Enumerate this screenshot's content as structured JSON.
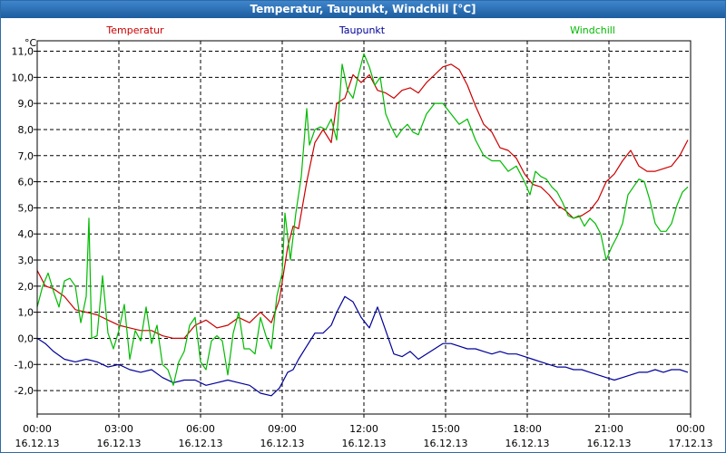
{
  "window": {
    "title": "Temperatur, Taupunkt, Windchill [°C]"
  },
  "chart_data": {
    "type": "line",
    "title": "Temperatur, Taupunkt, Windchill [°C]",
    "ylabel": "°C",
    "ylim": [
      -2.9,
      11.4
    ],
    "xlim": [
      0,
      24
    ],
    "grid": true,
    "y_ticks": [
      "11,0",
      "10,0",
      "9,0",
      "8,0",
      "7,0",
      "6,0",
      "5,0",
      "4,0",
      "3,0",
      "2,0",
      "1,0",
      "0,0",
      "-1,0",
      "-2,0"
    ],
    "y_tick_values": [
      11,
      10,
      9,
      8,
      7,
      6,
      5,
      4,
      3,
      2,
      1,
      0,
      -1,
      -2
    ],
    "x_ticks": [
      {
        "hour": 0,
        "time": "00:00",
        "date": "16.12.13"
      },
      {
        "hour": 3,
        "time": "03:00",
        "date": "16.12.13"
      },
      {
        "hour": 6,
        "time": "06:00",
        "date": "16.12.13"
      },
      {
        "hour": 9,
        "time": "09:00",
        "date": "16.12.13"
      },
      {
        "hour": 12,
        "time": "12:00",
        "date": "16.12.13"
      },
      {
        "hour": 15,
        "time": "15:00",
        "date": "16.12.13"
      },
      {
        "hour": 18,
        "time": "18:00",
        "date": "16.12.13"
      },
      {
        "hour": 21,
        "time": "21:00",
        "date": "16.12.13"
      },
      {
        "hour": 24,
        "time": "00:00",
        "date": "17.12.13"
      }
    ],
    "series": [
      {
        "name": "Temperatur",
        "color": "#cc0000",
        "x": [
          0,
          0.3,
          0.6,
          1.0,
          1.4,
          1.8,
          2.2,
          2.6,
          3.0,
          3.4,
          3.8,
          4.2,
          4.6,
          5.0,
          5.4,
          5.8,
          6.2,
          6.6,
          7.0,
          7.4,
          7.8,
          8.2,
          8.6,
          8.9,
          9.2,
          9.4,
          9.6,
          9.9,
          10.2,
          10.5,
          10.8,
          11.0,
          11.3,
          11.6,
          11.9,
          12.2,
          12.5,
          12.8,
          13.1,
          13.4,
          13.7,
          14.0,
          14.3,
          14.6,
          14.9,
          15.2,
          15.5,
          15.8,
          16.1,
          16.4,
          16.7,
          17.0,
          17.3,
          17.6,
          17.9,
          18.2,
          18.5,
          18.8,
          19.1,
          19.4,
          19.7,
          20.0,
          20.3,
          20.6,
          20.9,
          21.2,
          21.5,
          21.8,
          22.1,
          22.4,
          22.7,
          23.0,
          23.3,
          23.6,
          23.9
        ],
        "y": [
          2.6,
          2.0,
          1.9,
          1.6,
          1.1,
          1.0,
          0.9,
          0.7,
          0.5,
          0.4,
          0.3,
          0.3,
          0.1,
          0.0,
          0.0,
          0.5,
          0.7,
          0.4,
          0.5,
          0.8,
          0.6,
          1.0,
          0.6,
          1.5,
          3.5,
          4.3,
          4.2,
          6.0,
          7.5,
          8.0,
          7.5,
          9.0,
          9.2,
          10.1,
          9.8,
          10.1,
          9.5,
          9.4,
          9.2,
          9.5,
          9.6,
          9.4,
          9.8,
          10.1,
          10.4,
          10.5,
          10.3,
          9.7,
          8.9,
          8.2,
          7.9,
          7.3,
          7.2,
          6.9,
          6.3,
          5.9,
          5.8,
          5.5,
          5.1,
          4.9,
          4.6,
          4.7,
          4.9,
          5.3,
          6.0,
          6.3,
          6.8,
          7.2,
          6.6,
          6.4,
          6.4,
          6.5,
          6.6,
          7.0,
          7.6
        ]
      },
      {
        "name": "Taupunkt",
        "color": "#000099",
        "x": [
          0,
          0.3,
          0.6,
          1.0,
          1.4,
          1.8,
          2.2,
          2.6,
          3.0,
          3.4,
          3.8,
          4.2,
          4.6,
          5.0,
          5.4,
          5.8,
          6.2,
          6.6,
          7.0,
          7.4,
          7.8,
          8.2,
          8.6,
          8.9,
          9.2,
          9.4,
          9.6,
          9.9,
          10.2,
          10.5,
          10.8,
          11.0,
          11.3,
          11.6,
          11.9,
          12.2,
          12.5,
          12.8,
          13.1,
          13.4,
          13.7,
          14.0,
          14.3,
          14.6,
          14.9,
          15.2,
          15.5,
          15.8,
          16.1,
          16.4,
          16.7,
          17.0,
          17.3,
          17.6,
          17.9,
          18.2,
          18.5,
          18.8,
          19.1,
          19.4,
          19.7,
          20.0,
          20.3,
          20.6,
          20.9,
          21.2,
          21.5,
          21.8,
          22.1,
          22.4,
          22.7,
          23.0,
          23.3,
          23.6,
          23.9
        ],
        "y": [
          0.0,
          -0.2,
          -0.5,
          -0.8,
          -0.9,
          -0.8,
          -0.9,
          -1.1,
          -1.0,
          -1.2,
          -1.3,
          -1.2,
          -1.5,
          -1.7,
          -1.6,
          -1.6,
          -1.8,
          -1.7,
          -1.6,
          -1.7,
          -1.8,
          -2.1,
          -2.2,
          -1.9,
          -1.3,
          -1.2,
          -0.8,
          -0.3,
          0.2,
          0.2,
          0.5,
          1.0,
          1.6,
          1.4,
          0.8,
          0.4,
          1.2,
          0.3,
          -0.6,
          -0.7,
          -0.5,
          -0.8,
          -0.6,
          -0.4,
          -0.2,
          -0.2,
          -0.3,
          -0.4,
          -0.4,
          -0.5,
          -0.6,
          -0.5,
          -0.6,
          -0.6,
          -0.7,
          -0.8,
          -0.9,
          -1.0,
          -1.1,
          -1.1,
          -1.2,
          -1.2,
          -1.3,
          -1.4,
          -1.5,
          -1.6,
          -1.5,
          -1.4,
          -1.3,
          -1.3,
          -1.2,
          -1.3,
          -1.2,
          -1.2,
          -1.3
        ]
      },
      {
        "name": "Windchill",
        "color": "#00bb00",
        "x": [
          0,
          0.2,
          0.4,
          0.6,
          0.8,
          1.0,
          1.2,
          1.4,
          1.6,
          1.8,
          1.9,
          2.0,
          2.2,
          2.4,
          2.6,
          2.8,
          3.0,
          3.2,
          3.4,
          3.6,
          3.8,
          4.0,
          4.2,
          4.4,
          4.6,
          4.8,
          5.0,
          5.2,
          5.4,
          5.6,
          5.8,
          6.0,
          6.2,
          6.4,
          6.6,
          6.8,
          7.0,
          7.2,
          7.4,
          7.6,
          7.8,
          8.0,
          8.2,
          8.4,
          8.6,
          8.8,
          9.0,
          9.1,
          9.3,
          9.5,
          9.7,
          9.9,
          10.0,
          10.2,
          10.4,
          10.6,
          10.8,
          11.0,
          11.2,
          11.4,
          11.6,
          11.8,
          12.0,
          12.2,
          12.4,
          12.6,
          12.8,
          13.0,
          13.2,
          13.4,
          13.6,
          13.8,
          14.0,
          14.3,
          14.6,
          14.9,
          15.2,
          15.5,
          15.8,
          16.1,
          16.4,
          16.7,
          17.0,
          17.3,
          17.6,
          17.9,
          18.1,
          18.3,
          18.5,
          18.7,
          18.9,
          19.1,
          19.3,
          19.5,
          19.7,
          19.9,
          20.1,
          20.3,
          20.5,
          20.7,
          20.9,
          21.1,
          21.3,
          21.5,
          21.7,
          21.9,
          22.1,
          22.3,
          22.5,
          22.7,
          22.9,
          23.1,
          23.3,
          23.5,
          23.7,
          23.9
        ],
        "y": [
          1.2,
          2.0,
          2.5,
          1.8,
          1.2,
          2.2,
          2.3,
          2.0,
          0.6,
          1.6,
          4.6,
          0.0,
          0.1,
          2.4,
          0.2,
          -0.4,
          0.3,
          1.3,
          -0.8,
          0.3,
          -0.1,
          1.2,
          -0.2,
          0.5,
          -1.0,
          -1.2,
          -1.8,
          -0.9,
          -0.5,
          0.5,
          0.8,
          -0.9,
          -1.2,
          -0.1,
          0.1,
          -0.1,
          -1.4,
          0.2,
          1.0,
          -0.4,
          -0.4,
          -0.6,
          0.8,
          0.1,
          -0.4,
          1.6,
          2.5,
          4.8,
          3.0,
          4.8,
          6.2,
          8.8,
          7.4,
          8.0,
          8.1,
          8.0,
          8.4,
          7.6,
          10.5,
          9.5,
          9.2,
          10.1,
          10.9,
          10.4,
          9.7,
          10.0,
          8.6,
          8.1,
          7.7,
          8.0,
          8.2,
          7.9,
          7.8,
          8.6,
          9.0,
          9.0,
          8.6,
          8.2,
          8.4,
          7.6,
          7.0,
          6.8,
          6.8,
          6.4,
          6.6,
          6.0,
          5.5,
          6.4,
          6.2,
          6.1,
          5.8,
          5.6,
          5.2,
          4.7,
          4.6,
          4.7,
          4.3,
          4.6,
          4.4,
          4.0,
          3.0,
          3.5,
          3.9,
          4.4,
          5.5,
          5.8,
          6.1,
          6.0,
          5.3,
          4.4,
          4.1,
          4.1,
          4.4,
          5.1,
          5.6,
          5.8
        ]
      }
    ]
  }
}
